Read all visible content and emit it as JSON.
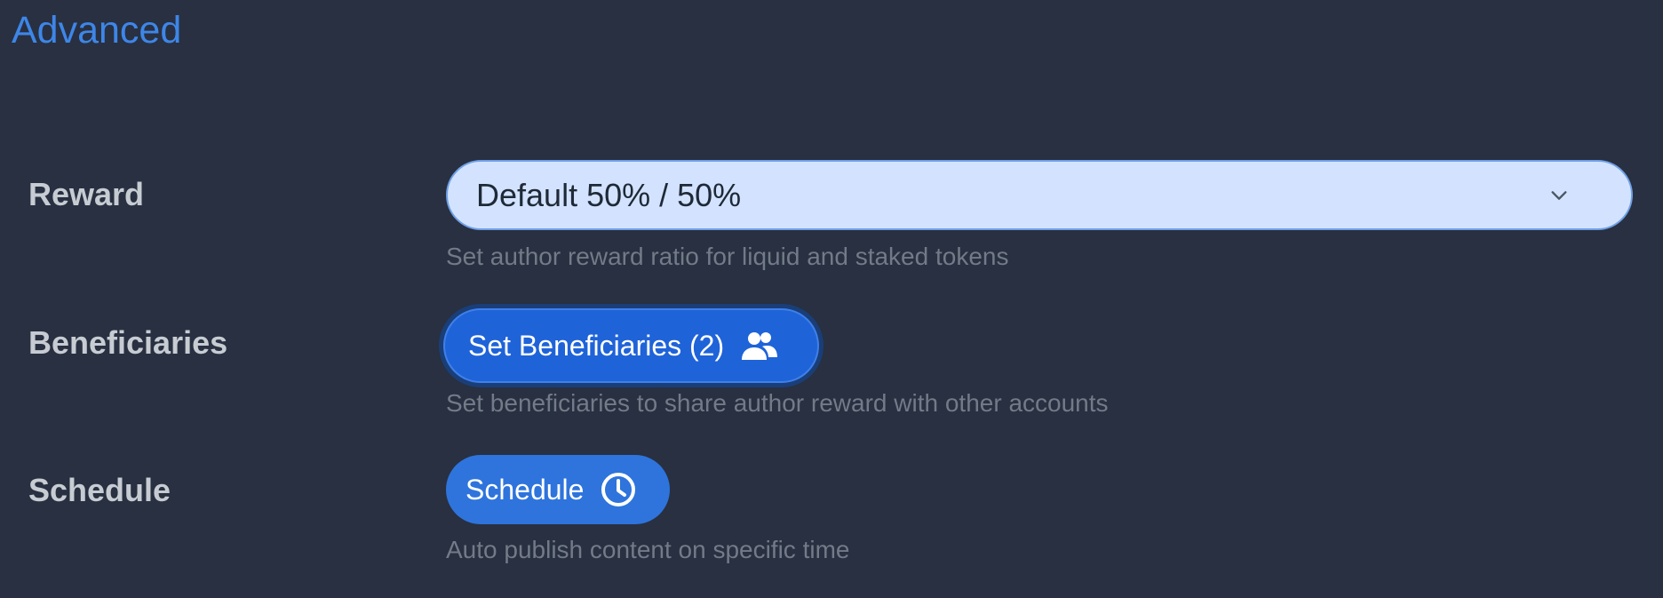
{
  "section": {
    "title": "Advanced"
  },
  "reward": {
    "label": "Reward",
    "selected_value": "Default 50% / 50%",
    "help": "Set author reward ratio for liquid and staked tokens",
    "icon": "chevron-down-icon"
  },
  "beneficiaries": {
    "label": "Beneficiaries",
    "button_label": "Set Beneficiaries (2)",
    "help": "Set beneficiaries to share author reward with other accounts",
    "icon": "people-icon"
  },
  "schedule": {
    "label": "Schedule",
    "button_label": "Schedule",
    "help": "Auto publish content on specific time",
    "icon": "clock-icon"
  },
  "colors": {
    "background": "#283041",
    "accent": "#3e86e8",
    "select_background": "#d3e3ff",
    "button_primary": "#1f63d8",
    "button_schedule": "#2e74dc",
    "label_text": "#c7ccd3",
    "help_text": "#727b87"
  }
}
